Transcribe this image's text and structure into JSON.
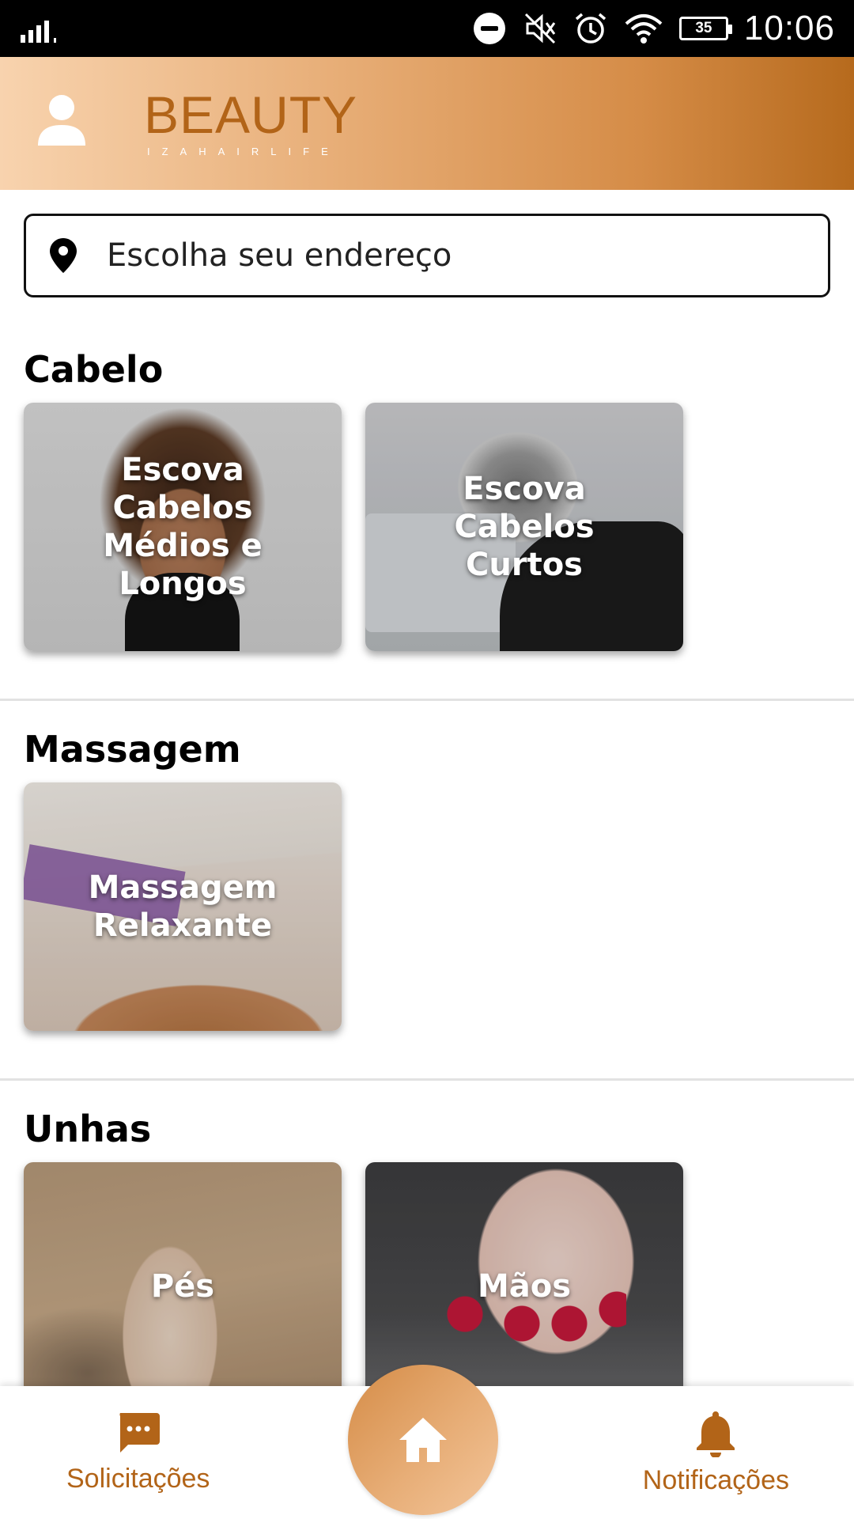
{
  "status_bar": {
    "time": "10:06",
    "battery": "35",
    "icons": [
      "signal-icon",
      "do-not-disturb-icon",
      "mute-icon",
      "alarm-icon",
      "wifi-icon",
      "battery-icon"
    ]
  },
  "header": {
    "logo_main": "BEAUTY",
    "logo_sub": "IZAHAIRLIFE",
    "brand_color": "#b26418"
  },
  "address": {
    "placeholder": "Escolha seu endereço"
  },
  "sections": [
    {
      "title": "Cabelo",
      "cards": [
        {
          "label": "Escova Cabelos Médios e Longos"
        },
        {
          "label": "Escova Cabelos Curtos"
        }
      ]
    },
    {
      "title": "Massagem",
      "cards": [
        {
          "label": "Massagem Relaxante"
        }
      ]
    },
    {
      "title": "Unhas",
      "cards": [
        {
          "label": "Pés"
        },
        {
          "label": "Mãos"
        }
      ]
    }
  ],
  "bottom_nav": {
    "requests_label": "Solicitações",
    "notifications_label": "Notificações",
    "active": "home"
  }
}
